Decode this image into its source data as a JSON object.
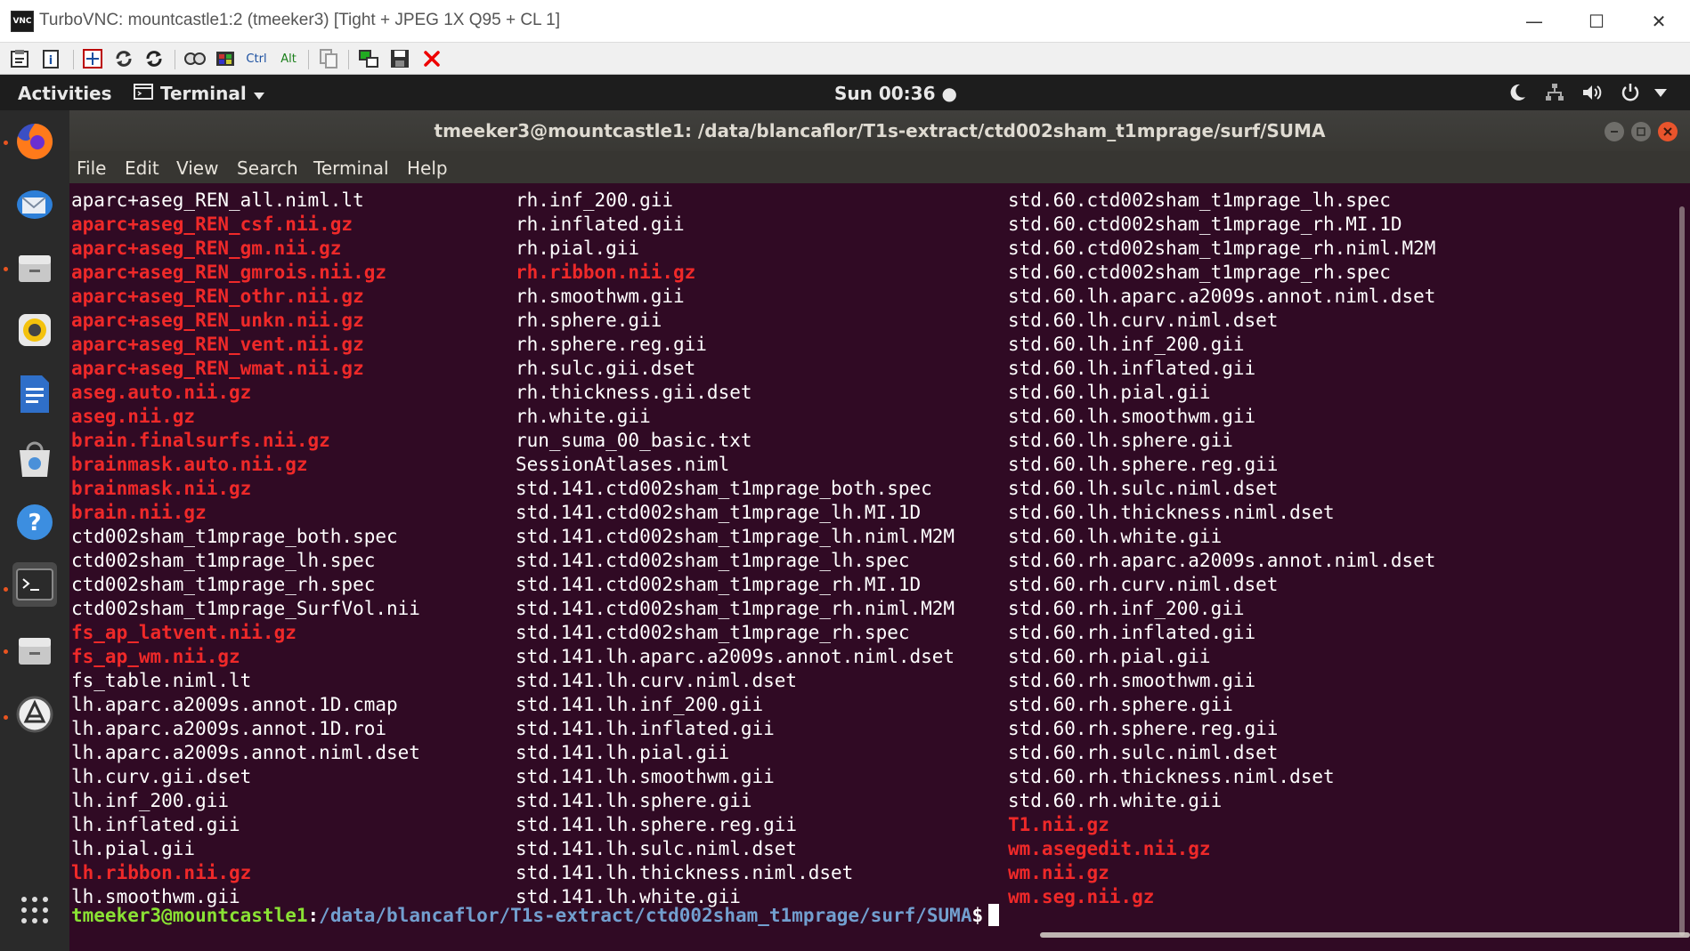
{
  "window": {
    "title": "TurboVNC: mountcastle1:2 (tmeeker3) [Tight + JPEG 1X Q95 + CL 1]",
    "logo_text": "VNC",
    "minimize": "—",
    "maximize": "☐",
    "close": "✕"
  },
  "toolbar": {
    "ctrl_label": "Ctrl",
    "alt_label": "Alt"
  },
  "topbar": {
    "activities": "Activities",
    "app_name": "Terminal",
    "clock": "Sun 00:36 ●"
  },
  "terminal": {
    "title": "tmeeker3@mountcastle1: /data/blancaflor/T1s-extract/ctd002sham_t1mprage/surf/SUMA",
    "menu": [
      "File",
      "Edit",
      "View",
      "Search",
      "Terminal",
      "Help"
    ],
    "columns": [
      [
        {
          "text": "aparc+aseg_REN_all.niml.lt",
          "red": false
        },
        {
          "text": "aparc+aseg_REN_csf.nii.gz",
          "red": true
        },
        {
          "text": "aparc+aseg_REN_gm.nii.gz",
          "red": true
        },
        {
          "text": "aparc+aseg_REN_gmrois.nii.gz",
          "red": true
        },
        {
          "text": "aparc+aseg_REN_othr.nii.gz",
          "red": true
        },
        {
          "text": "aparc+aseg_REN_unkn.nii.gz",
          "red": true
        },
        {
          "text": "aparc+aseg_REN_vent.nii.gz",
          "red": true
        },
        {
          "text": "aparc+aseg_REN_wmat.nii.gz",
          "red": true
        },
        {
          "text": "aseg.auto.nii.gz",
          "red": true
        },
        {
          "text": "aseg.nii.gz",
          "red": true
        },
        {
          "text": "brain.finalsurfs.nii.gz",
          "red": true
        },
        {
          "text": "brainmask.auto.nii.gz",
          "red": true
        },
        {
          "text": "brainmask.nii.gz",
          "red": true
        },
        {
          "text": "brain.nii.gz",
          "red": true
        },
        {
          "text": "ctd002sham_t1mprage_both.spec",
          "red": false
        },
        {
          "text": "ctd002sham_t1mprage_lh.spec",
          "red": false
        },
        {
          "text": "ctd002sham_t1mprage_rh.spec",
          "red": false
        },
        {
          "text": "ctd002sham_t1mprage_SurfVol.nii",
          "red": false
        },
        {
          "text": "fs_ap_latvent.nii.gz",
          "red": true
        },
        {
          "text": "fs_ap_wm.nii.gz",
          "red": true
        },
        {
          "text": "fs_table.niml.lt",
          "red": false
        },
        {
          "text": "lh.aparc.a2009s.annot.1D.cmap",
          "red": false
        },
        {
          "text": "lh.aparc.a2009s.annot.1D.roi",
          "red": false
        },
        {
          "text": "lh.aparc.a2009s.annot.niml.dset",
          "red": false
        },
        {
          "text": "lh.curv.gii.dset",
          "red": false
        },
        {
          "text": "lh.inf_200.gii",
          "red": false
        },
        {
          "text": "lh.inflated.gii",
          "red": false
        },
        {
          "text": "lh.pial.gii",
          "red": false
        },
        {
          "text": "lh.ribbon.nii.gz",
          "red": true
        },
        {
          "text": "lh.smoothwm.gii",
          "red": false
        }
      ],
      [
        {
          "text": "rh.inf_200.gii",
          "red": false
        },
        {
          "text": "rh.inflated.gii",
          "red": false
        },
        {
          "text": "rh.pial.gii",
          "red": false
        },
        {
          "text": "rh.ribbon.nii.gz",
          "red": true
        },
        {
          "text": "rh.smoothwm.gii",
          "red": false
        },
        {
          "text": "rh.sphere.gii",
          "red": false
        },
        {
          "text": "rh.sphere.reg.gii",
          "red": false
        },
        {
          "text": "rh.sulc.gii.dset",
          "red": false
        },
        {
          "text": "rh.thickness.gii.dset",
          "red": false
        },
        {
          "text": "rh.white.gii",
          "red": false
        },
        {
          "text": "run_suma_00_basic.txt",
          "red": false
        },
        {
          "text": "SessionAtlases.niml",
          "red": false
        },
        {
          "text": "std.141.ctd002sham_t1mprage_both.spec",
          "red": false
        },
        {
          "text": "std.141.ctd002sham_t1mprage_lh.MI.1D",
          "red": false
        },
        {
          "text": "std.141.ctd002sham_t1mprage_lh.niml.M2M",
          "red": false
        },
        {
          "text": "std.141.ctd002sham_t1mprage_lh.spec",
          "red": false
        },
        {
          "text": "std.141.ctd002sham_t1mprage_rh.MI.1D",
          "red": false
        },
        {
          "text": "std.141.ctd002sham_t1mprage_rh.niml.M2M",
          "red": false
        },
        {
          "text": "std.141.ctd002sham_t1mprage_rh.spec",
          "red": false
        },
        {
          "text": "std.141.lh.aparc.a2009s.annot.niml.dset",
          "red": false
        },
        {
          "text": "std.141.lh.curv.niml.dset",
          "red": false
        },
        {
          "text": "std.141.lh.inf_200.gii",
          "red": false
        },
        {
          "text": "std.141.lh.inflated.gii",
          "red": false
        },
        {
          "text": "std.141.lh.pial.gii",
          "red": false
        },
        {
          "text": "std.141.lh.smoothwm.gii",
          "red": false
        },
        {
          "text": "std.141.lh.sphere.gii",
          "red": false
        },
        {
          "text": "std.141.lh.sphere.reg.gii",
          "red": false
        },
        {
          "text": "std.141.lh.sulc.niml.dset",
          "red": false
        },
        {
          "text": "std.141.lh.thickness.niml.dset",
          "red": false
        },
        {
          "text": "std.141.lh.white.gii",
          "red": false
        }
      ],
      [
        {
          "text": "std.60.ctd002sham_t1mprage_lh.spec",
          "red": false
        },
        {
          "text": "std.60.ctd002sham_t1mprage_rh.MI.1D",
          "red": false
        },
        {
          "text": "std.60.ctd002sham_t1mprage_rh.niml.M2M",
          "red": false
        },
        {
          "text": "std.60.ctd002sham_t1mprage_rh.spec",
          "red": false
        },
        {
          "text": "std.60.lh.aparc.a2009s.annot.niml.dset",
          "red": false
        },
        {
          "text": "std.60.lh.curv.niml.dset",
          "red": false
        },
        {
          "text": "std.60.lh.inf_200.gii",
          "red": false
        },
        {
          "text": "std.60.lh.inflated.gii",
          "red": false
        },
        {
          "text": "std.60.lh.pial.gii",
          "red": false
        },
        {
          "text": "std.60.lh.smoothwm.gii",
          "red": false
        },
        {
          "text": "std.60.lh.sphere.gii",
          "red": false
        },
        {
          "text": "std.60.lh.sphere.reg.gii",
          "red": false
        },
        {
          "text": "std.60.lh.sulc.niml.dset",
          "red": false
        },
        {
          "text": "std.60.lh.thickness.niml.dset",
          "red": false
        },
        {
          "text": "std.60.lh.white.gii",
          "red": false
        },
        {
          "text": "std.60.rh.aparc.a2009s.annot.niml.dset",
          "red": false
        },
        {
          "text": "std.60.rh.curv.niml.dset",
          "red": false
        },
        {
          "text": "std.60.rh.inf_200.gii",
          "red": false
        },
        {
          "text": "std.60.rh.inflated.gii",
          "red": false
        },
        {
          "text": "std.60.rh.pial.gii",
          "red": false
        },
        {
          "text": "std.60.rh.smoothwm.gii",
          "red": false
        },
        {
          "text": "std.60.rh.sphere.gii",
          "red": false
        },
        {
          "text": "std.60.rh.sphere.reg.gii",
          "red": false
        },
        {
          "text": "std.60.rh.sulc.niml.dset",
          "red": false
        },
        {
          "text": "std.60.rh.thickness.niml.dset",
          "red": false
        },
        {
          "text": "std.60.rh.white.gii",
          "red": false
        },
        {
          "text": "T1.nii.gz",
          "red": true
        },
        {
          "text": "wm.asegedit.nii.gz",
          "red": true
        },
        {
          "text": "wm.nii.gz",
          "red": true
        },
        {
          "text": "wm.seg.nii.gz",
          "red": true
        }
      ]
    ],
    "prompt": {
      "user_host": "tmeeker3@mountcastle1",
      "colon": ":",
      "path": "/data/blancaflor/T1s-extract/ctd002sham_t1mprage/surf/SUMA",
      "dollar": "$"
    }
  },
  "colors": {
    "terminal_bg": "#300a24",
    "archive_red": "#ef2929",
    "prompt_green": "#8ae234",
    "prompt_blue": "#729fcf"
  }
}
